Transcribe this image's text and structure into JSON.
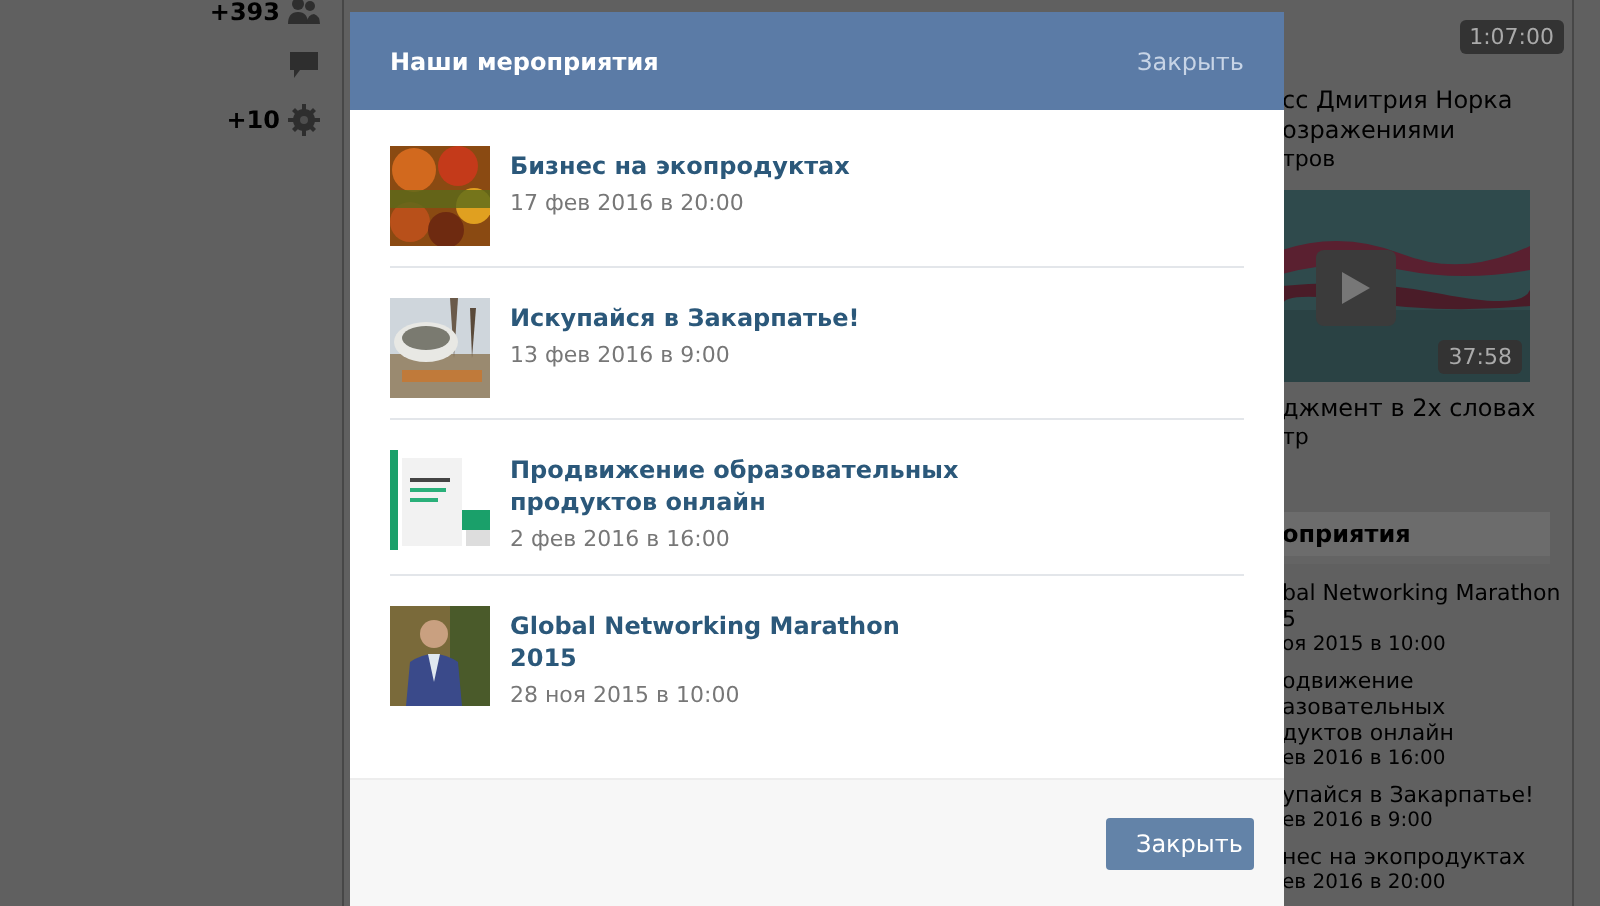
{
  "page": {
    "stats": [
      {
        "kind": "members",
        "count": "+393"
      },
      {
        "kind": "comments"
      },
      {
        "kind": "settings",
        "count": "+10"
      }
    ],
    "right_column": {
      "videos": [
        {
          "duration": "1:07:00",
          "title_lines": [
            "сс Дмитрия Норка",
            "озражениями"
          ],
          "meta": "тров"
        },
        {
          "duration": "37:58",
          "title_lines": [
            "джмент в 2х словах"
          ],
          "meta": "тр",
          "thumbnail": {
            "kind": "picture"
          }
        }
      ],
      "events_header": "оприятия",
      "events": [
        {
          "title_lines": [
            "bal Networking Marathon",
            "5"
          ],
          "date": "оя 2015 в 10:00"
        },
        {
          "title_lines": [
            "одвижение",
            "азовательных",
            "дуктов онлайн"
          ],
          "date": "ев 2016 в 16:00"
        },
        {
          "title_lines": [
            "упайся в Закарпатье!"
          ],
          "date": "ев 2016 в 9:00"
        },
        {
          "title_lines": [
            "нес на экопродуктах"
          ],
          "date": "ев 2016 в 20:00"
        }
      ]
    }
  },
  "modal": {
    "title": "Наши мероприятия",
    "header_close": "Закрыть",
    "events": [
      {
        "title": "Бизнес на экопродуктах",
        "date": "17 фев 2016 в 20:00",
        "thumbnail": {
          "kind": "picture"
        }
      },
      {
        "title": "Искупайся в Закарпатье!",
        "date": "13 фев 2016 в 9:00",
        "thumbnail": {
          "kind": "picture"
        }
      },
      {
        "title": "Продвижение образовательных продуктов онлайн",
        "date": "2 фев 2016 в 16:00",
        "thumbnail": {
          "kind": "picture"
        }
      },
      {
        "title": "Global Networking Marathon 2015",
        "date": "28 ноя 2015 в 10:00",
        "thumbnail": {
          "kind": "picture"
        }
      }
    ],
    "footer_button": "Закрыть"
  }
}
